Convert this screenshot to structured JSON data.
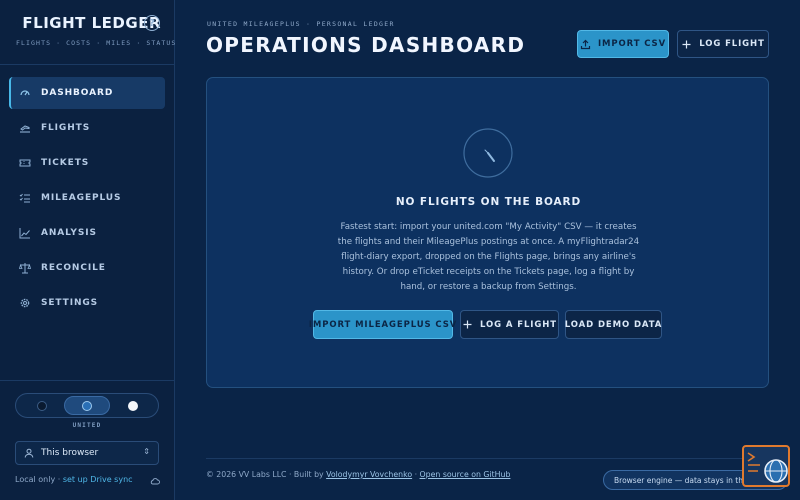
{
  "app": {
    "title": "FLIGHT LEDGER",
    "subtitle": "FLIGHTS · COSTS · MILES · STATUS",
    "help_icon": "help-circle-icon"
  },
  "sidebar": {
    "items": [
      {
        "label": "DASHBOARD",
        "icon": "gauge-icon",
        "active": true
      },
      {
        "label": "FLIGHTS",
        "icon": "plane-icon",
        "active": false
      },
      {
        "label": "TICKETS",
        "icon": "ticket-icon",
        "active": false
      },
      {
        "label": "MILEAGEPLUS",
        "icon": "checklist-icon",
        "active": false
      },
      {
        "label": "ANALYSIS",
        "icon": "trend-icon",
        "active": false
      },
      {
        "label": "RECONCILE",
        "icon": "scale-icon",
        "active": false
      },
      {
        "label": "SETTINGS",
        "icon": "gear-icon",
        "active": false
      }
    ],
    "theme": {
      "label": "UNITED",
      "options": [
        "dark",
        "united",
        "light"
      ],
      "selected": "united"
    },
    "storage": {
      "value": "This browser",
      "icon": "user-icon"
    },
    "sync": {
      "text": "Local only · ",
      "link": "set up Drive sync",
      "icon": "cloud-icon"
    }
  },
  "header": {
    "kicker": "UNITED MILEAGEPLUS · PERSONAL LEDGER",
    "title": "OPERATIONS DASHBOARD",
    "import_label": "IMPORT CSV",
    "log_label": "LOG FLIGHT"
  },
  "empty_state": {
    "icon": "gauge-dial-icon",
    "title": "NO FLIGHTS ON THE BOARD",
    "description": "Fastest start: import your united.com \"My Activity\" CSV — it creates the flights and their MileagePlus postings at once. A myFlightradar24 flight-diary export, dropped on the Flights page, brings any airline's history. Or drop eTicket receipts on the Tickets page, log a flight by hand, or restore a backup from Settings.",
    "actions": {
      "import_mp": "IMPORT MILEAGEPLUS CSV",
      "log_flight": "LOG A FLIGHT",
      "demo": "LOAD DEMO DATA"
    }
  },
  "footer": {
    "prefix": "© 2026 VV Labs LLC · Built by ",
    "author": "Volodymyr Vovchenko",
    "sep": " · ",
    "source": "Open source on GitHub",
    "engine_pill": "Browser engine — data stays in this browser"
  },
  "colors": {
    "background": "#0a2447",
    "sidebar": "#0b2140",
    "accent": "#2b94c9",
    "panel": "#0d3160"
  }
}
